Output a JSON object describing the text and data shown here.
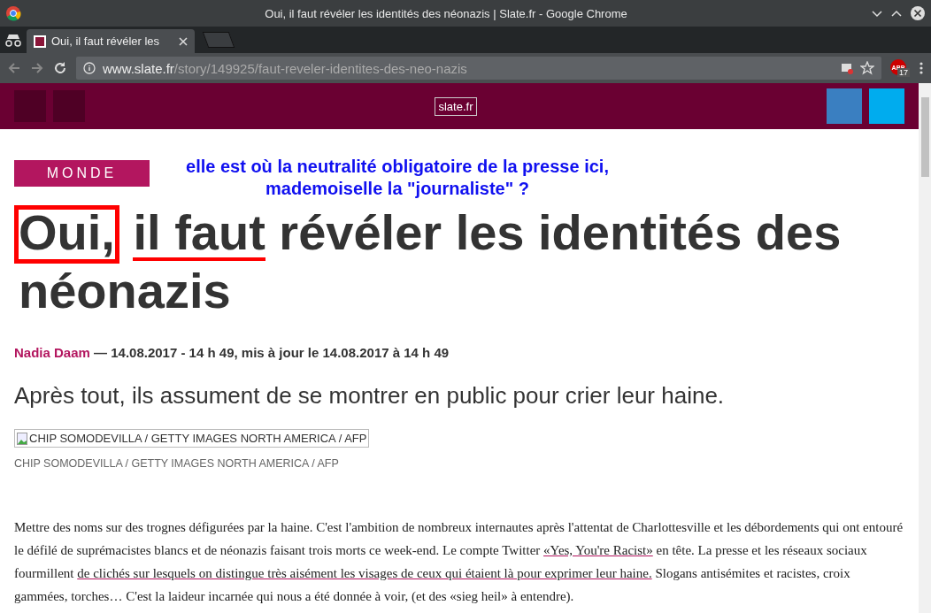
{
  "window": {
    "title": "Oui, il faut révéler les identités des néonazis | Slate.fr - Google Chrome"
  },
  "tabs": [
    {
      "label": "Oui, il faut révéler les",
      "selected": true
    }
  ],
  "address_bar": {
    "domain": "www.slate.fr",
    "path": "/story/149925/faut-reveler-identites-des-neo-nazis"
  },
  "extension_badge": {
    "label": "ABP",
    "count": "17"
  },
  "site_header": {
    "logo_alt": "slate.fr"
  },
  "article": {
    "category": "MONDE",
    "annotation": "elle est où la neutralité obligatoire de la presse ici, mademoiselle la \"journaliste\" ?",
    "title_parts": [
      {
        "text": "Oui,",
        "kind": "boxed"
      },
      {
        "text": "il faut",
        "kind": "underlined"
      },
      {
        "text": "révéler les identités des néonazis",
        "kind": "plain"
      }
    ],
    "author": "Nadia Daam",
    "dateline": "— 14.08.2017 - 14 h 49, mis à jour le 14.08.2017 à 14 h 49",
    "subtitle": "Après tout, ils assument de se montrer en public pour crier leur haine.",
    "image_alt": "CHIP SOMODEVILLA / GETTY IMAGES NORTH AMERICA / AFP",
    "caption": "CHIP SOMODEVILLA / GETTY IMAGES NORTH AMERICA / AFP",
    "paragraph": [
      {
        "kind": "text",
        "text": "Mettre des noms sur des trognes défigurées par la haine. C'est l'ambition de nombreux internautes après l'attentat de Charlottesville et les débordements qui ont entouré le défilé de suprémacistes blancs et de néonazis faisant trois morts ce week-end. Le compte Twitter "
      },
      {
        "kind": "link",
        "text": "«Yes, You're Racist»"
      },
      {
        "kind": "text",
        "text": " en tête. La presse et les réseaux sociaux fourmillent "
      },
      {
        "kind": "link",
        "text": "de clichés sur lesquels on distingue très aisément les visages de ceux qui étaient là pour exprimer leur haine."
      },
      {
        "kind": "text",
        "text": " Slogans antisémites et racistes, croix gammées, torches… C'est la laideur incarnée qui nous a été donnée à voir, (et des «sieg heil» à entendre)."
      }
    ]
  }
}
